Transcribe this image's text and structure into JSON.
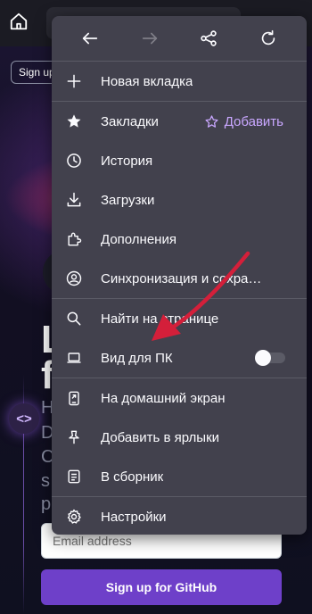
{
  "browser": {
    "home_icon": "home-icon"
  },
  "page": {
    "signup_small": "Sign up",
    "hero_lines": [
      "L",
      "f"
    ],
    "hero_sub_lines": [
      "H",
      "D",
      "C",
      "s",
      "p"
    ],
    "email_placeholder": "Email address",
    "signup_button": "Sign up for GitHub"
  },
  "menu": {
    "nav": {
      "back_icon": "arrow-left-icon",
      "forward_icon": "arrow-right-icon",
      "share_icon": "share-icon",
      "reload_icon": "reload-icon"
    },
    "items": [
      {
        "id": "new-tab",
        "label": "Новая вкладка",
        "icon": "plus-icon"
      },
      {
        "id": "bookmarks",
        "label": "Закладки",
        "icon": "star-icon",
        "extra": "Добавить",
        "extra_icon": "star-outline-icon"
      },
      {
        "id": "history",
        "label": "История",
        "icon": "clock-icon"
      },
      {
        "id": "downloads",
        "label": "Загрузки",
        "icon": "download-icon"
      },
      {
        "id": "addons",
        "label": "Дополнения",
        "icon": "puzzle-icon"
      },
      {
        "id": "sync",
        "label": "Синхронизация и сохра…",
        "icon": "account-icon"
      },
      {
        "id": "find",
        "label": "Найти на странице",
        "icon": "search-icon"
      },
      {
        "id": "desktop",
        "label": "Вид для ПК",
        "icon": "laptop-icon",
        "toggle": false
      },
      {
        "id": "homescreen",
        "label": "На домашний экран",
        "icon": "add-to-homescreen-icon"
      },
      {
        "id": "shortcuts",
        "label": "Добавить в ярлыки",
        "icon": "pin-icon"
      },
      {
        "id": "collection",
        "label": "В сборник",
        "icon": "collection-icon"
      },
      {
        "id": "settings",
        "label": "Настройки",
        "icon": "gear-icon"
      }
    ]
  },
  "colors": {
    "menu_bg": "#42414d",
    "accent": "#c9a7ff",
    "arrow": "#d41f3a",
    "github_button": "#6e40c9"
  }
}
